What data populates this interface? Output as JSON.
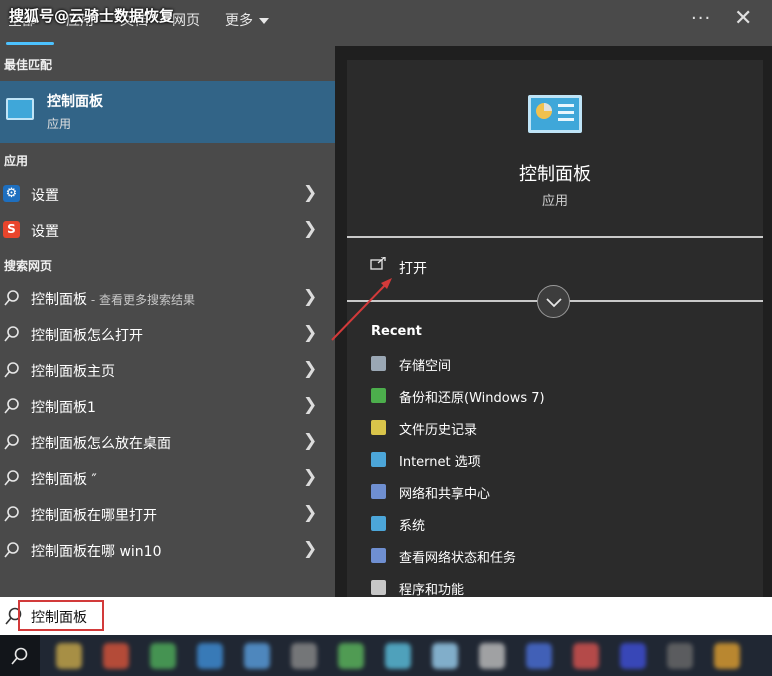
{
  "watermark": "搜狐号@云骑士数据恢复",
  "topbar": {
    "tabs": [
      "全部",
      "应用",
      "文档",
      "网页",
      "更多"
    ],
    "more_label": "更多",
    "dots": "···",
    "close": "✕"
  },
  "left": {
    "best_match_header": "最佳匹配",
    "best_match": {
      "title": "控制面板",
      "subtitle": "应用"
    },
    "apps_header": "应用",
    "apps": [
      {
        "label": "设置",
        "icon": "gear-icon"
      },
      {
        "label": "设置",
        "icon": "sogou-icon"
      }
    ],
    "web_header": "搜索网页",
    "web_first": {
      "label": "控制面板",
      "suffix": " - 查看更多搜索结果"
    },
    "web_results": [
      "控制面板怎么打开",
      "控制面板主页",
      "控制面板1",
      "控制面板怎么放在桌面",
      "控制面板 ″",
      "控制面板在哪里打开",
      "控制面板在哪 win10"
    ]
  },
  "right": {
    "app_name": "控制面板",
    "app_type": "应用",
    "open_label": "打开",
    "recent_header": "Recent",
    "recent": [
      {
        "label": "存储空间",
        "icon": "storage-icon"
      },
      {
        "label": "备份和还原(Windows 7)",
        "icon": "backup-icon"
      },
      {
        "label": "文件历史记录",
        "icon": "file-history-icon"
      },
      {
        "label": "Internet 选项",
        "icon": "internet-options-icon"
      },
      {
        "label": "网络和共享中心",
        "icon": "network-icon"
      },
      {
        "label": "系统",
        "icon": "system-icon"
      },
      {
        "label": "查看网络状态和任务",
        "icon": "network-status-icon"
      },
      {
        "label": "程序和功能",
        "icon": "programs-icon"
      }
    ]
  },
  "search": {
    "value": "控制面板"
  },
  "colors": {
    "accent": "#4cc2ff",
    "selection": "#326487",
    "annotation": "#d23a3a"
  }
}
